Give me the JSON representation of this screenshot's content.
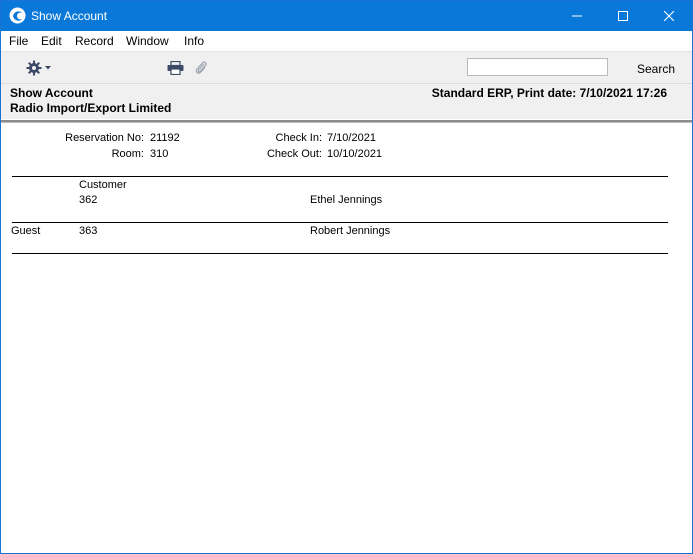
{
  "window": {
    "title": "Show Account"
  },
  "menu": {
    "items": [
      "File",
      "Edit",
      "Record",
      "Window",
      "Info"
    ]
  },
  "toolbar": {
    "search_value": "",
    "search_label": "Search"
  },
  "header": {
    "title": "Show Account",
    "company": "Radio Import/Export Limited",
    "right_info": "Standard ERP, Print date: 7/10/2021 17:26"
  },
  "report": {
    "reservation_label": "Reservation No:",
    "reservation_value": "21192",
    "room_label": "Room:",
    "room_value": "310",
    "checkin_label": "Check In:",
    "checkin_value": "7/10/2021",
    "checkout_label": "Check Out:",
    "checkout_value": "10/10/2021",
    "customer_heading": "Customer",
    "customer_code": "362",
    "customer_name": "Ethel Jennings",
    "guest_label": "Guest",
    "guest_code": "363",
    "guest_name": "Robert Jennings"
  }
}
